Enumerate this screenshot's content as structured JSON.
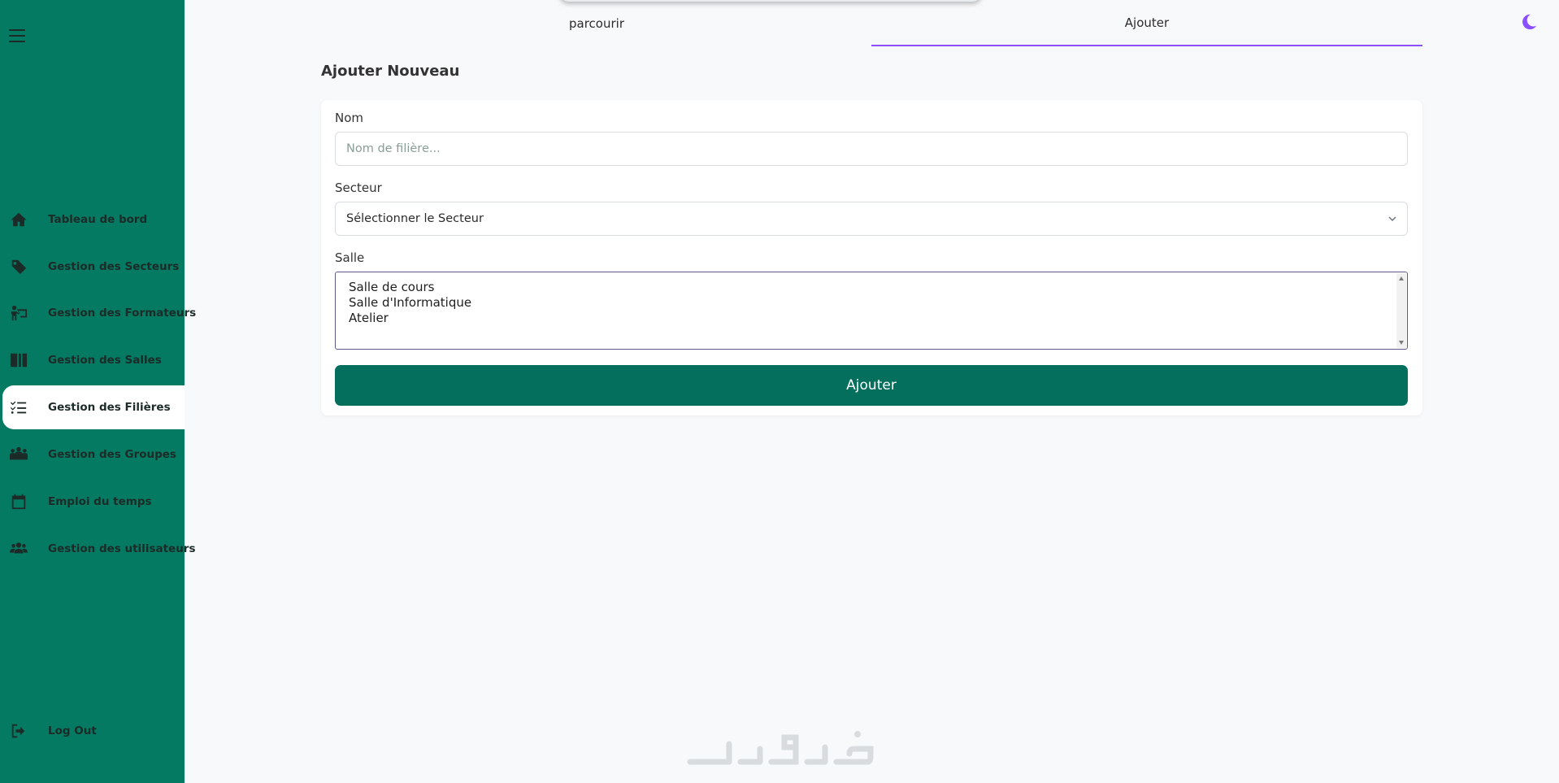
{
  "sidebar": {
    "items": [
      {
        "label": "Tableau de bord",
        "icon": "home-icon"
      },
      {
        "label": "Gestion des Secteurs",
        "icon": "tag-icon"
      },
      {
        "label": "Gestion des Formateurs",
        "icon": "teacher-icon"
      },
      {
        "label": "Gestion des Salles",
        "icon": "rooms-icon"
      },
      {
        "label": "Gestion des Filières",
        "icon": "list-check-icon",
        "active": true
      },
      {
        "label": "Gestion des Groupes",
        "icon": "people-group-icon"
      },
      {
        "label": "Emploi du temps",
        "icon": "calendar-icon"
      },
      {
        "label": "Gestion des utilisateurs",
        "icon": "users-icon"
      }
    ],
    "logout": {
      "label": "Log Out",
      "icon": "logout-icon"
    }
  },
  "tabs": [
    {
      "label": "parcourir"
    },
    {
      "label": "Ajouter",
      "active": true
    }
  ],
  "theme_toggle": {
    "icon": "moon-icon",
    "color": "#8a4fff"
  },
  "form": {
    "title": "Ajouter Nouveau",
    "nom_label": "Nom",
    "nom_placeholder": "Nom de filière...",
    "nom_value": "",
    "secteur_label": "Secteur",
    "secteur_selected": "Sélectionner le Secteur",
    "salle_label": "Salle",
    "salle_options": [
      "Salle de cours",
      "Salle d'Informatique",
      "Atelier"
    ],
    "submit_label": "Ajouter"
  },
  "colors": {
    "sidebar": "#047a63",
    "primary_button": "#046f5c",
    "accent": "#8a4fff",
    "background": "#f8f9fb"
  }
}
